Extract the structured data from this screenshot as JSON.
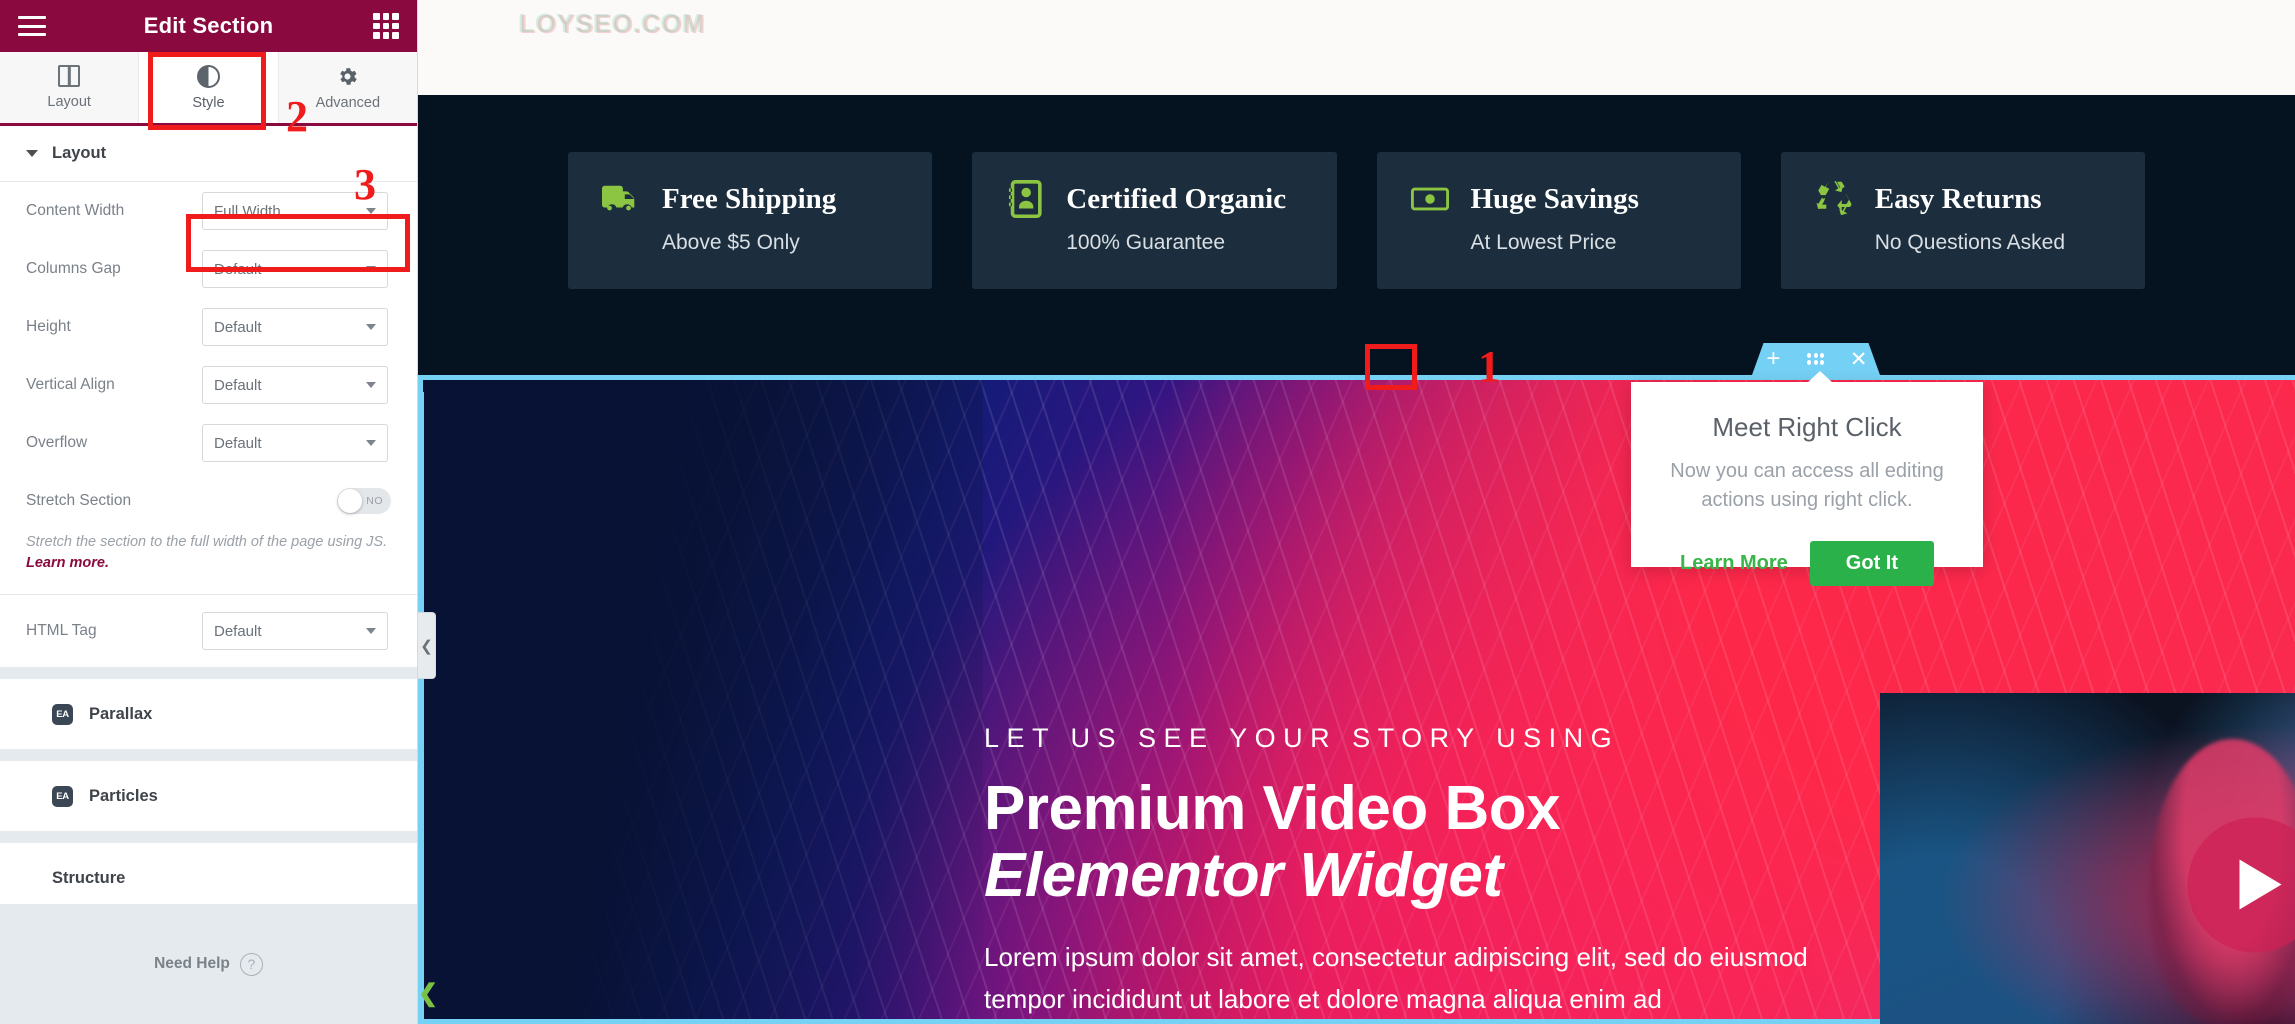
{
  "panel": {
    "title": "Edit Section",
    "menu_icon": "hamburger-icon",
    "grid_icon": "apps-grid-icon",
    "tabs": [
      {
        "label": "Layout",
        "icon": "layout-columns-icon",
        "active": false
      },
      {
        "label": "Style",
        "icon": "contrast-half-circle-icon",
        "active": true
      },
      {
        "label": "Advanced",
        "icon": "gear-icon",
        "active": false
      }
    ],
    "section_header": {
      "label": "Layout",
      "caret": "caret-down-icon"
    },
    "controls": [
      {
        "label": "Content Width",
        "value": "Full Width",
        "type": "select"
      },
      {
        "label": "Columns Gap",
        "value": "Default",
        "type": "select"
      },
      {
        "label": "Height",
        "value": "Default",
        "type": "select"
      },
      {
        "label": "Vertical Align",
        "value": "Default",
        "type": "select"
      },
      {
        "label": "Overflow",
        "value": "Default",
        "type": "select"
      }
    ],
    "stretch": {
      "label": "Stretch Section",
      "toggle_state": "NO"
    },
    "helper": {
      "text": "Stretch the section to the full width of the page using JS. ",
      "link": "Learn more."
    },
    "html_tag": {
      "label": "HTML Tag",
      "value": "Default"
    },
    "accordions": [
      {
        "label": "Parallax",
        "badge": "EA",
        "caret": "caret-right-icon"
      },
      {
        "label": "Particles",
        "badge": "EA",
        "caret": "caret-right-icon"
      },
      {
        "label": "Structure",
        "badge": null,
        "caret": "caret-right-icon"
      }
    ],
    "footer": {
      "label": "Need Help",
      "icon": "question-circle-icon"
    },
    "collapse_handle": {
      "icon": "chevron-left-icon"
    },
    "green_chevron": {
      "icon": "chevron-left-icon"
    }
  },
  "canvas": {
    "watermark": "LOYSEO.COM",
    "cards": [
      {
        "icon": "truck-icon",
        "title": "Free Shipping",
        "subtitle": "Above $5 Only"
      },
      {
        "icon": "certificate-icon",
        "title": "Certified Organic",
        "subtitle": "100% Guarantee"
      },
      {
        "icon": "money-bill-icon",
        "title": "Huge Savings",
        "subtitle": "At Lowest Price"
      },
      {
        "icon": "recycle-icon",
        "title": "Easy Returns",
        "subtitle": "No Questions Asked"
      }
    ],
    "section_toolbar": {
      "add_icon": "plus-icon",
      "edit_icon": "six-dots-handle-icon",
      "close_icon": "close-x-icon"
    },
    "hero": {
      "kicker": "LET US SEE YOUR STORY USING",
      "title_line1": "Premium Video Box",
      "title_line2": "Elementor Widget",
      "paragraph": "Lorem ipsum dolor sit amet, consectetur adipiscing elit, sed do eiusmod tempor incididunt ut labore et dolore magna aliqua enim ad"
    },
    "video_box": {
      "play_icon": "play-triangle-icon"
    }
  },
  "popup": {
    "title": "Meet Right Click",
    "body": "Now you can access all editing actions using right click.",
    "learn_more": "Learn More",
    "got_it": "Got It"
  },
  "annotations": {
    "one": "1",
    "two": "2",
    "three": "3"
  },
  "colors": {
    "brand_maroon": "#8a0a3f",
    "annotation_red": "#f01b1b",
    "editing_blue": "#76d2f5",
    "accent_green": "#8cc542",
    "button_green": "#2bb14a",
    "card_bg": "#1c2e3d",
    "dark_band": "#04131f"
  }
}
